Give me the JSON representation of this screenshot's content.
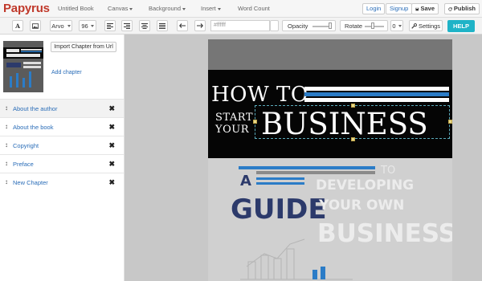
{
  "app": {
    "brand": "Papyrus",
    "book_title": "Untitled Book"
  },
  "nav": {
    "menus": [
      {
        "label": "Canvas"
      },
      {
        "label": "Background"
      },
      {
        "label": "Insert"
      }
    ],
    "word_count": "Word Count",
    "login": "Login",
    "signup": "Signup",
    "save": "Save",
    "publish": "Publish"
  },
  "toolbar": {
    "font_family": "Arvo",
    "font_size": "96",
    "color_value": "#ffffff",
    "opacity_label": "Opacity",
    "opacity_level": 0.9,
    "rotate_label": "Rotate",
    "rotate_value": "0",
    "settings_label": "Settings",
    "help_label": "HELP"
  },
  "sidebar": {
    "import_label": "Import Chapter from Url",
    "add_chapter_label": "Add chapter",
    "chapters": [
      {
        "label": "About the author",
        "active": true
      },
      {
        "label": "About the book",
        "active": false
      },
      {
        "label": "Copyright",
        "active": false
      },
      {
        "label": "Preface",
        "active": false
      },
      {
        "label": "New Chapter",
        "active": false
      }
    ]
  },
  "cover": {
    "line1": "HOW TO",
    "line2a": "START",
    "line2b": "YOUR",
    "line3": "BUSINESS",
    "sub_a": "A",
    "sub_guide": "GUIDE",
    "sub_to": "TO",
    "sub_developing": "DEVELOPING",
    "sub_yourown": "YOUR OWN",
    "sub_business": "BUSINESS",
    "colors": {
      "blue": "#2b7cc7",
      "navy": "#2c3a6b",
      "grey_text": "#e8e8e8",
      "brand_red": "#c0392b",
      "help_teal": "#1fb3c7"
    }
  }
}
